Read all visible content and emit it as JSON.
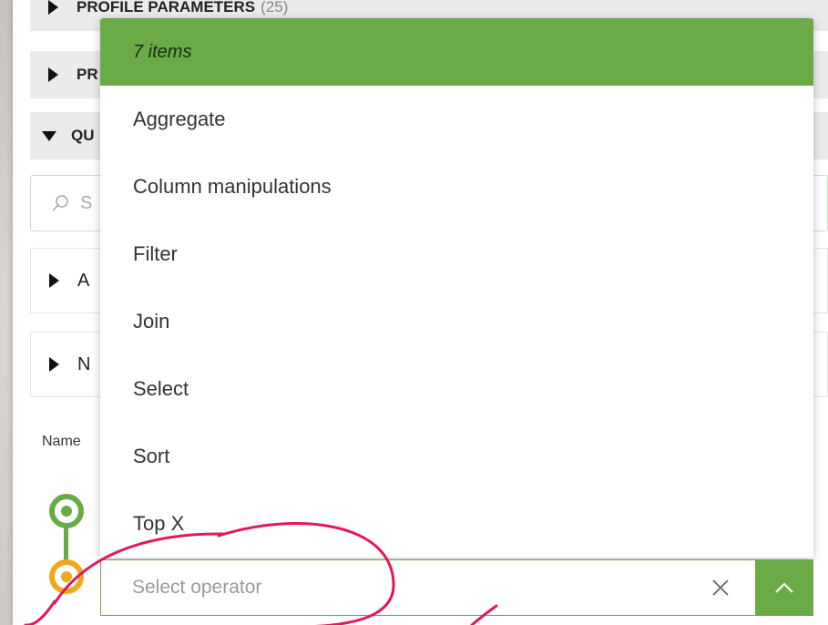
{
  "sections": {
    "profile_parameters": {
      "label": "PROFILE PARAMETERS",
      "count": "(25)"
    },
    "second": {
      "label": "PR"
    },
    "third": {
      "label": "QU"
    }
  },
  "search": {
    "placeholder": "S"
  },
  "subsections": [
    {
      "label": "A"
    },
    {
      "label": "N"
    }
  ],
  "name_label": "Name",
  "dropdown": {
    "header": "7 items",
    "items": [
      {
        "label": "Aggregate"
      },
      {
        "label": "Column manipulations"
      },
      {
        "label": "Filter"
      },
      {
        "label": "Join"
      },
      {
        "label": "Select"
      },
      {
        "label": "Sort"
      },
      {
        "label": "Top X"
      }
    ]
  },
  "operator_select": {
    "placeholder": "Select operator",
    "clear_icon": "close-icon",
    "toggle_icon": "chevron-up-icon"
  },
  "colors": {
    "accent_green": "#6aab47",
    "node_orange": "#f0a71a",
    "annotation_pink": "#e0185f"
  }
}
